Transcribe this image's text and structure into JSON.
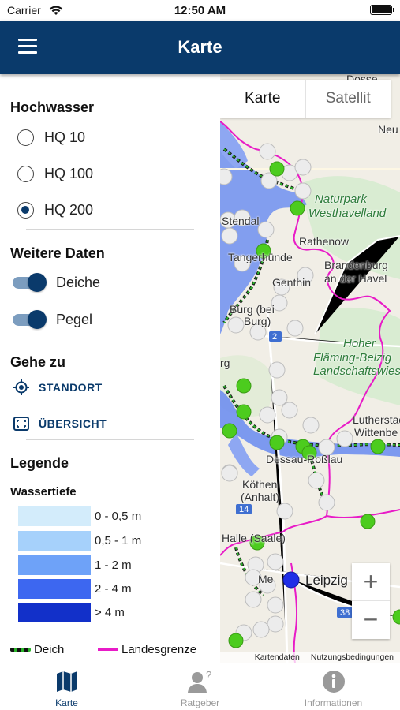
{
  "status_bar": {
    "carrier": "Carrier",
    "time": "12:50 AM"
  },
  "header": {
    "title": "Karte",
    "menu_icon": "hamburger-menu-icon"
  },
  "sidebar": {
    "hochwasser": {
      "title": "Hochwasser",
      "options": [
        {
          "label": "HQ 10",
          "selected": false
        },
        {
          "label": "HQ 100",
          "selected": false
        },
        {
          "label": "HQ 200",
          "selected": true
        }
      ]
    },
    "weitere_daten": {
      "title": "Weitere Daten",
      "toggles": [
        {
          "label": "Deiche",
          "on": true
        },
        {
          "label": "Pegel",
          "on": true
        }
      ]
    },
    "gehe_zu": {
      "title": "Gehe zu",
      "items": [
        {
          "label": "STANDORT",
          "icon": "locate-icon"
        },
        {
          "label": "ÜBERSICHT",
          "icon": "overview-frame-icon"
        }
      ]
    },
    "legende": {
      "title": "Legende",
      "wassertiefe_title": "Wassertiefe",
      "depths": [
        {
          "label": "0 - 0,5 m",
          "color": "#d3ecfb"
        },
        {
          "label": "0,5 - 1 m",
          "color": "#a6d1fb"
        },
        {
          "label": "1 - 2 m",
          "color": "#6ea2f8"
        },
        {
          "label": "2 - 4 m",
          "color": "#3d67f0"
        },
        {
          "label": "> 4 m",
          "color": "#1230c9"
        }
      ],
      "lines": [
        {
          "label": "Deich",
          "color": "#2ab52a"
        },
        {
          "label": "Landesgrenze",
          "color": "#e81bc7"
        }
      ]
    }
  },
  "map": {
    "type_control": {
      "active": "Karte",
      "inactive": "Satellit"
    },
    "labels": {
      "dosse": "Dosse",
      "neu": "Neu",
      "naturpark_1": "Naturpark",
      "naturpark_2": "Westhavelland",
      "stendal": "Stendal",
      "rathenow": "Rathenow",
      "brandenburg_1": "Brandenburg",
      "brandenburg_2": "an der Havel",
      "tanger": "Tangerhünde",
      "genthin": "Genthin",
      "burg": "Burg (bei",
      "burg2": "Burg)",
      "hoher_1": "Hoher",
      "hoher_2": "Fläming-Belzig",
      "hoher_3": "Landschaftswies",
      "rg": "rg",
      "lutherstadt_1": "Lutherstad",
      "lutherstadt_2": "Wittenbe",
      "dessau": "Dessau-Roßlau",
      "koethen_1": "Köthen",
      "koethen_2": "(Anhalt)",
      "halle": "Halle (Saale)",
      "leipzig": "Leipzig",
      "road_2": "2",
      "road_14": "14",
      "road_38": "38",
      "me": "Me"
    },
    "zoom_in": "+",
    "zoom_out": "−",
    "attribution": {
      "data": "Kartendaten",
      "terms": "Nutzungsbedingungen"
    },
    "colors": {
      "river": "#6f8ff0",
      "border": "#e81bc7",
      "dike_green": "#2ab52a",
      "gauge_green": "#4ccc1e",
      "gauge_white": "#ececec",
      "gauge_blue": "#1f2ee6"
    }
  },
  "tabbar": {
    "tabs": [
      {
        "label": "Karte",
        "icon": "map-icon",
        "active": true
      },
      {
        "label": "Ratgeber",
        "icon": "person-question-icon",
        "active": false
      },
      {
        "label": "Informationen",
        "icon": "info-icon",
        "active": false
      }
    ]
  }
}
